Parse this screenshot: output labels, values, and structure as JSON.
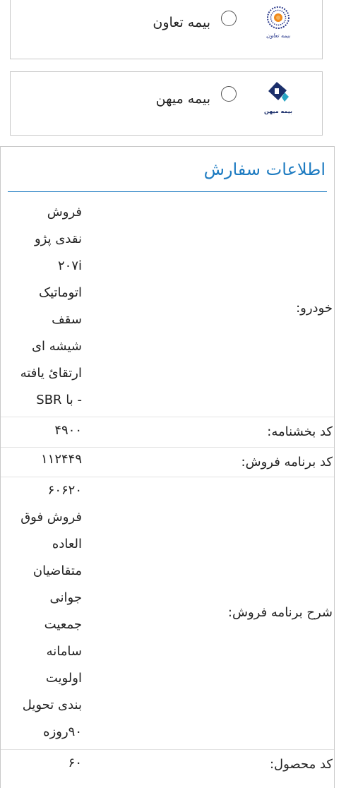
{
  "insurers": [
    {
      "name": "بیمه تعاون",
      "logo_icon": "bimeh-taavon-logo-icon",
      "logo_caption": "بیمه تعاون",
      "selected": false
    },
    {
      "name": "بیمه میهن",
      "logo_icon": "bimeh-mihan-logo-icon",
      "logo_caption": "بیمه میهن",
      "selected": false
    }
  ],
  "order": {
    "title": "اطلاعات سفارش",
    "rows": [
      {
        "label": "خودرو:",
        "value_lines": [
          "فروش",
          "نقدی پژو",
          "۲۰۷i",
          "اتوماتیک",
          "سقف",
          "شیشه ای",
          "ارتقائ یافته",
          "- با SBR"
        ]
      },
      {
        "label": "کد بخشنامه:",
        "value_lines": [
          "۴۹۰۰"
        ]
      },
      {
        "label": "کد برنامه فروش:",
        "value_lines": [
          "۱۱۲۴۴۹"
        ]
      },
      {
        "label": "شرح برنامه فروش:",
        "value_lines": [
          "۶۰۶۲۰",
          "فروش فوق",
          "العاده",
          "متقاضیان",
          "جوانی",
          "جمعیت",
          "سامانه",
          "اولویت",
          "بندی تحویل",
          "۹۰روزه"
        ]
      },
      {
        "label": "کد محصول:",
        "value_lines": [
          "۶۰"
        ]
      }
    ]
  },
  "colors": {
    "accent": "#1d7bc1",
    "border": "#c9c9c9",
    "row_divider": "#e3e3e3",
    "taavon_orange": "#f08a1c",
    "taavon_navy": "#2b3a8c",
    "mihan_navy": "#1b2f6b",
    "mihan_teal": "#2aa6c4"
  }
}
